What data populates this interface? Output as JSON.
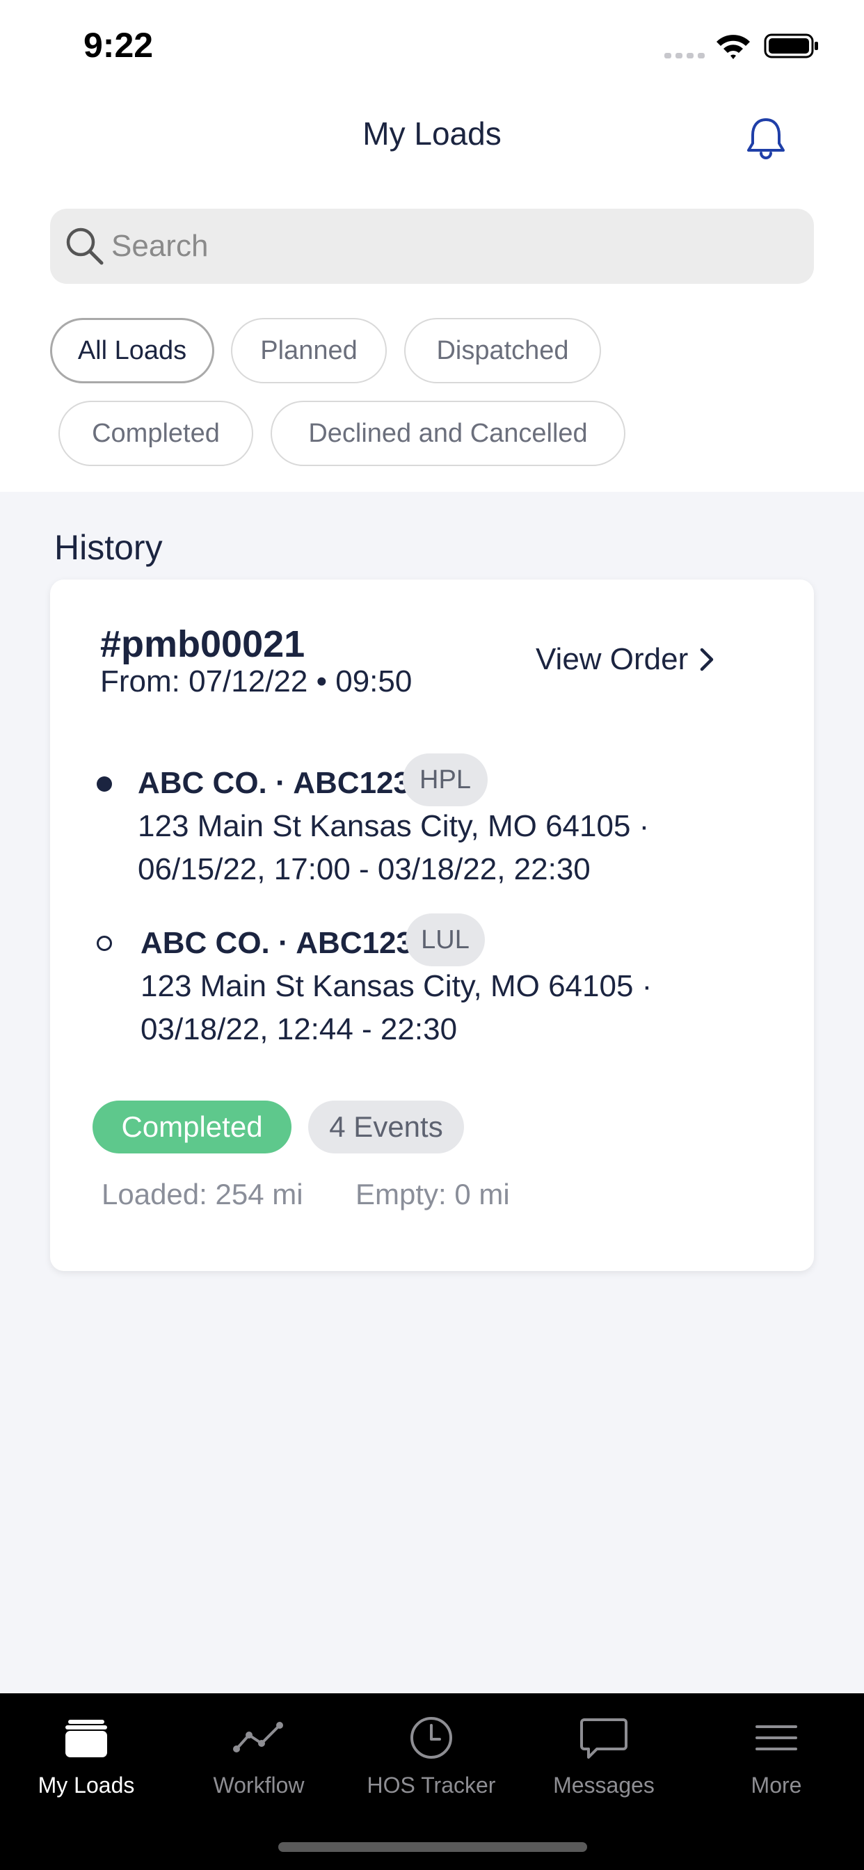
{
  "status_bar": {
    "time": "9:22"
  },
  "header": {
    "title": "My Loads"
  },
  "search": {
    "placeholder": "Search"
  },
  "filters": {
    "chips": [
      "All Loads",
      "Planned",
      "Dispatched",
      "Completed",
      "Declined and Cancelled"
    ],
    "active": "All Loads"
  },
  "history": {
    "heading": "History",
    "card": {
      "order_id": "#pmb00021",
      "from": "From: 07/12/22 • 09:50",
      "view_order_label": "View Order",
      "stops": [
        {
          "name": "ABC CO. · ABC123",
          "tag": "HPL",
          "address": "123 Main St Kansas City, MO 64105 ·",
          "time": "06/15/22, 17:00 - 03/18/22, 22:30",
          "marker": "filled"
        },
        {
          "name": "ABC CO. · ABC123",
          "tag": "LUL",
          "address": "123 Main St Kansas City, MO 64105 ·",
          "time": "03/18/22, 12:44 - 22:30",
          "marker": "hollow"
        }
      ],
      "status_label": "Completed",
      "events_label": "4 Events",
      "loaded": "Loaded: 254 mi",
      "empty": "Empty: 0 mi"
    }
  },
  "tabbar": {
    "tabs": [
      {
        "label": "My Loads",
        "icon": "truck-icon",
        "active": true
      },
      {
        "label": "Workflow",
        "icon": "workflow-icon",
        "active": false
      },
      {
        "label": "HOS Tracker",
        "icon": "clock-icon",
        "active": false
      },
      {
        "label": "Messages",
        "icon": "message-icon",
        "active": false
      },
      {
        "label": "More",
        "icon": "menu-icon",
        "active": false
      }
    ]
  },
  "colors": {
    "primary_text": "#1b2440",
    "completed_badge": "#5ec88c",
    "background": "#f4f5f9",
    "tabbar": "#000000"
  }
}
